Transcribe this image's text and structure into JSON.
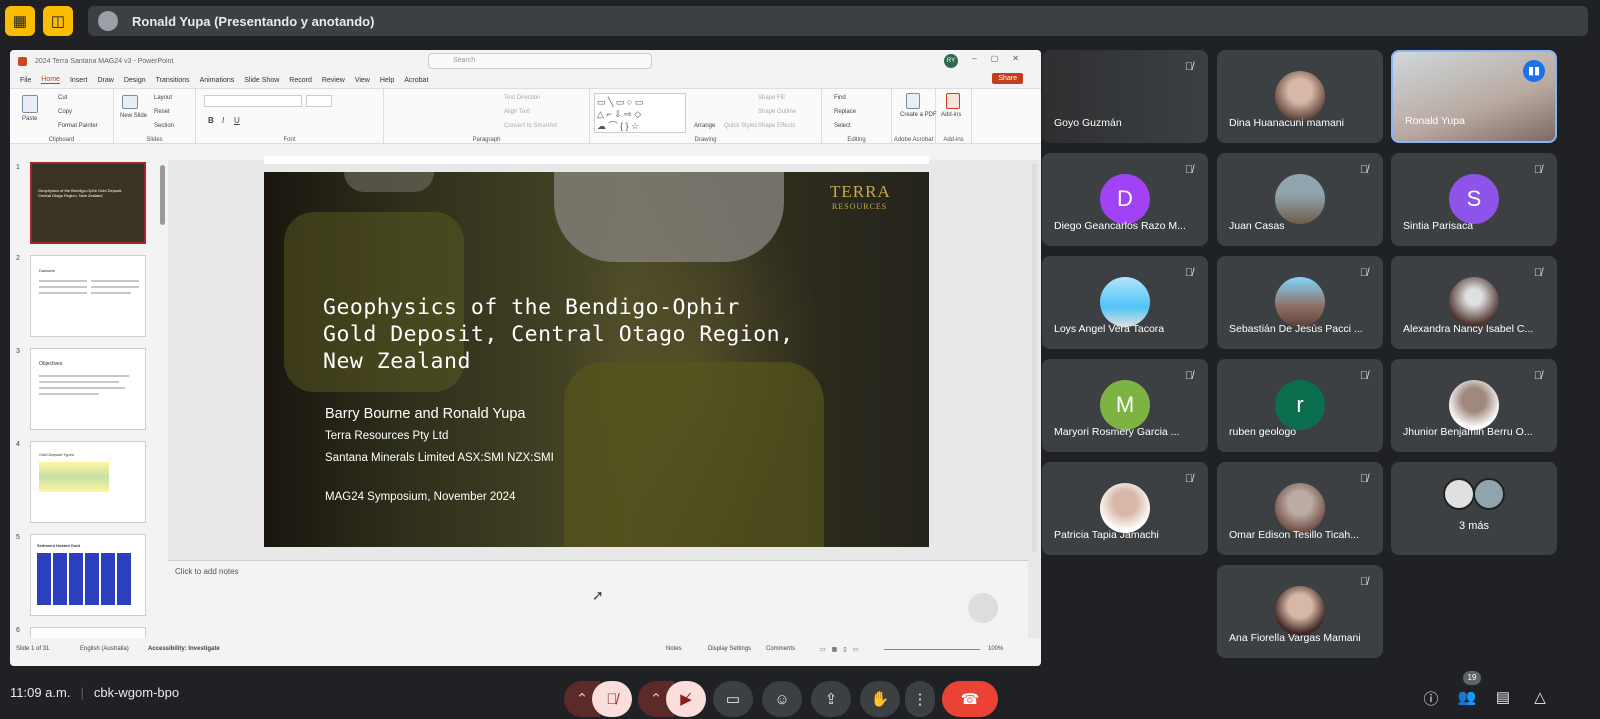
{
  "meeting": {
    "presenter_label": "Ronald Yupa (Presentando y anotando)",
    "time": "11:09 a.m.",
    "code": "cbk-wgom-bpo",
    "participants_count": "19"
  },
  "ppt": {
    "window_title": "2024 Terra Santana MAG24 v3 - PowerPoint",
    "search_placeholder": "Search",
    "user_initials": "RY",
    "menu": [
      "File",
      "Home",
      "Insert",
      "Draw",
      "Design",
      "Transitions",
      "Animations",
      "Slide Show",
      "Record",
      "Review",
      "View",
      "Help",
      "Acrobat"
    ],
    "share_label": "Share",
    "ribbon": {
      "paste": "Paste",
      "cut": "Cut",
      "copy": "Copy",
      "format_painter": "Format Painter",
      "clipboard": "Clipboard",
      "new_slide": "New Slide",
      "layout": "Layout",
      "reset": "Reset",
      "section": "Section",
      "slides": "Slides",
      "font": "Font",
      "paragraph": "Paragraph",
      "text_direction": "Text Direction",
      "align_text": "Align Text",
      "convert_smartart": "Convert to SmartArt",
      "drawing": "Drawing",
      "arrange": "Arrange",
      "quick_styles": "Quick Styles",
      "shape_fill": "Shape Fill",
      "shape_outline": "Shape Outline",
      "shape_effects": "Shape Effects",
      "find": "Find",
      "replace": "Replace",
      "select": "Select",
      "editing": "Editing",
      "create_pdf": "Create a PDF",
      "adobe_acrobat": "Adobe Acrobat",
      "addins": "Add-ins",
      "addins_group": "Add-ins"
    },
    "thumb_numbers": [
      "1",
      "2",
      "3",
      "4",
      "5",
      "6"
    ],
    "thumb_titles": [
      "Geophysics of the Bendigo-Ophir Gold Deposit, Central Otago Region, New Zealand",
      "Datasets",
      "Objectives",
      "Gold Deposit Types",
      "Sediment Hosted Gold"
    ],
    "slide": {
      "title_line1": "Geophysics of the Bendigo-Ophir",
      "title_line2": "Gold Deposit, Central Otago Region,",
      "title_line3": "New Zealand",
      "authors": "Barry Bourne and Ronald Yupa",
      "affil1": "Terra Resources Pty Ltd",
      "affil2": "Santana Minerals Limited ASX:SMI NZX:SMI",
      "conference": "MAG24 Symposium, November 2024",
      "logo_line1": "TERRA",
      "logo_line2": "RESOURCES"
    },
    "notes_placeholder": "Click to add notes",
    "status": {
      "slide_count": "Slide 1 of 31",
      "language": "English (Australia)",
      "accessibility": "Accessibility: Investigate",
      "notes": "Notes",
      "display_settings": "Display Settings",
      "comments": "Comments",
      "zoom": "100%"
    }
  },
  "participants": [
    {
      "name": "Goyo Guzmán",
      "muted": true
    },
    {
      "name": "Dina Huanacuni mamani",
      "muted": false
    },
    {
      "name": "Ronald Yupa",
      "speaking": true
    },
    {
      "name": "Diego Geancarlos Razo M...",
      "initial": "D",
      "color": "#a142f4",
      "muted": true
    },
    {
      "name": "Juan Casas",
      "muted": true
    },
    {
      "name": "Sintia Parisaca",
      "initial": "S",
      "color": "#8e54e9",
      "muted": true
    },
    {
      "name": "Loys Angel Vera Tacora",
      "muted": true
    },
    {
      "name": "Sebastián De Jesús Pacci ...",
      "muted": true
    },
    {
      "name": "Alexandra Nancy Isabel C...",
      "muted": true
    },
    {
      "name": "Maryori Rosmery Garcia ...",
      "initial": "M",
      "color": "#7cb342",
      "muted": true
    },
    {
      "name": "ruben geologo",
      "initial": "r",
      "color": "#0b6e4f",
      "muted": true
    },
    {
      "name": "Jhunior Benjamin Berru O...",
      "muted": true
    },
    {
      "name": "Patricia Tapia Jamachi",
      "muted": true
    },
    {
      "name": "Omar Edison Tesillo Ticah...",
      "muted": true
    },
    {
      "name": "3 más",
      "muted": false
    },
    {
      "name": "Ana Fiorella Vargas Mamani",
      "muted": true
    }
  ],
  "icons": {
    "mic_off": "mic-off-icon",
    "camera_off": "camera-off-icon",
    "captions": "captions-icon",
    "emoji": "emoji-icon",
    "present": "present-icon",
    "hand": "raise-hand-icon",
    "more": "more-options-icon",
    "leave": "leave-call-icon",
    "info": "info-icon",
    "people": "people-icon",
    "chat": "chat-icon",
    "activities": "activities-icon"
  }
}
